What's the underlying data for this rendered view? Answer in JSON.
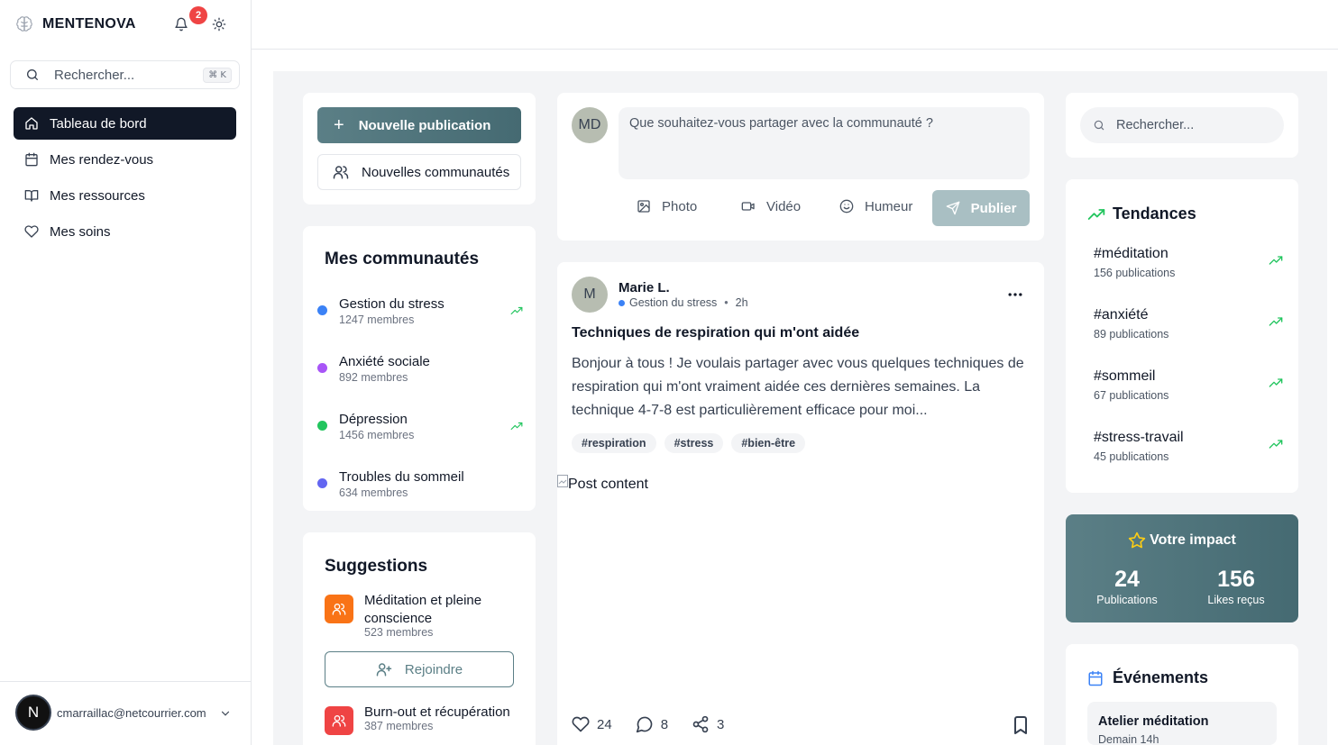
{
  "sidebar": {
    "brand": "MENTENOVA",
    "notification_count": "2",
    "search": {
      "placeholder": "Rechercher...",
      "shortcut": "⌘ K"
    },
    "nav": [
      {
        "label": "Tableau de bord",
        "icon": "home-icon",
        "active": true
      },
      {
        "label": "Mes rendez-vous",
        "icon": "calendar-icon"
      },
      {
        "label": "Mes ressources",
        "icon": "book-icon"
      },
      {
        "label": "Mes soins",
        "icon": "heart-icon"
      }
    ],
    "user": {
      "initial": "N",
      "email": "cmarraillac@netcourrier.com"
    }
  },
  "actions": {
    "new_post": "Nouvelle publication",
    "new_communities": "Nouvelles communautés"
  },
  "communities": {
    "title": "Mes communautés",
    "items": [
      {
        "name": "Gestion du stress",
        "members": "1247 membres",
        "color": "#3b82f6",
        "trending": true
      },
      {
        "name": "Anxiété sociale",
        "members": "892 membres",
        "color": "#a855f7",
        "trending": false
      },
      {
        "name": "Dépression",
        "members": "1456 membres",
        "color": "#22c55e",
        "trending": true
      },
      {
        "name": "Troubles du sommeil",
        "members": "634 membres",
        "color": "#6366f1",
        "trending": false
      }
    ]
  },
  "suggestions": {
    "title": "Suggestions",
    "items": [
      {
        "name": "Méditation et pleine conscience",
        "members": "523 membres",
        "color": "#f97316"
      },
      {
        "name": "Burn-out et récupération",
        "members": "387 membres",
        "color": "#ef4444"
      }
    ],
    "join_label": "Rejoindre"
  },
  "composer": {
    "avatar": "MD",
    "placeholder": "Que souhaitez-vous partager avec la communauté ?",
    "photo": "Photo",
    "video": "Vidéo",
    "mood": "Humeur",
    "publish": "Publier"
  },
  "post": {
    "avatar": "M",
    "author": "Marie L.",
    "community": "Gestion du stress",
    "time": "2h",
    "title": "Techniques de respiration qui m'ont aidée",
    "body": "Bonjour à tous ! Je voulais partager avec vous quelques techniques de respiration qui m'ont vraiment aidée ces dernières semaines. La technique 4-7-8 est particulièrement efficace pour moi...",
    "tags": [
      "#respiration",
      "#stress",
      "#bien-être"
    ],
    "image_alt": "Post content",
    "likes": "24",
    "comments": "8",
    "shares": "3"
  },
  "right_search": {
    "placeholder": "Rechercher..."
  },
  "trends": {
    "title": "Tendances",
    "items": [
      {
        "tag": "#méditation",
        "count": "156 publications"
      },
      {
        "tag": "#anxiété",
        "count": "89 publications"
      },
      {
        "tag": "#sommeil",
        "count": "67 publications"
      },
      {
        "tag": "#stress-travail",
        "count": "45 publications"
      }
    ]
  },
  "impact": {
    "title": "Votre impact",
    "publications": "24",
    "publications_label": "Publications",
    "likes": "156",
    "likes_label": "Likes reçus"
  },
  "events": {
    "title": "Événements",
    "items": [
      {
        "name": "Atelier méditation",
        "time": "Demain 14h"
      }
    ]
  }
}
